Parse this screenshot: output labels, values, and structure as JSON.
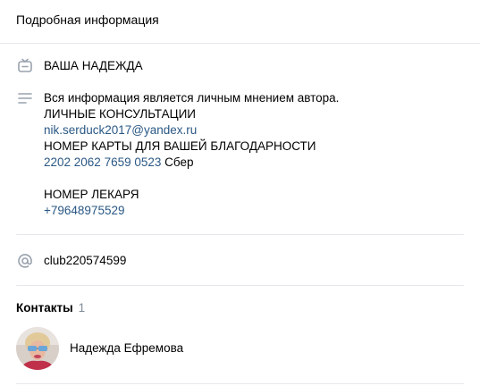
{
  "header": {
    "title": "Подробная информация"
  },
  "status": {
    "text": "ВАША НАДЕЖДА",
    "icon": "status-badge-icon"
  },
  "description": {
    "icon": "text-lines-icon",
    "line1": "Вся информация является личным мнением автора.",
    "line2": "ЛИЧНЫЕ КОНСУЛЬТАЦИИ",
    "email": "nik.serduck2017@yandex.ru",
    "line4": "НОМЕР КАРТЫ ДЛЯ ВАШЕЙ БЛАГОДАРНОСТИ",
    "card_number": "2202 2062 7659 0523",
    "card_bank": " Сбер",
    "line7": "НОМЕР ЛЕКАРЯ",
    "phone": "+79648975529"
  },
  "address": {
    "icon": "at-sign-icon",
    "text": "club220574599"
  },
  "contacts": {
    "title": "Контакты",
    "count": "1",
    "items": [
      {
        "name": "Надежда Ефремова"
      }
    ]
  },
  "colors": {
    "link": "#2a5885",
    "icon": "#99a2ad",
    "divider": "#e7e8ec",
    "muted": "#818c99"
  }
}
